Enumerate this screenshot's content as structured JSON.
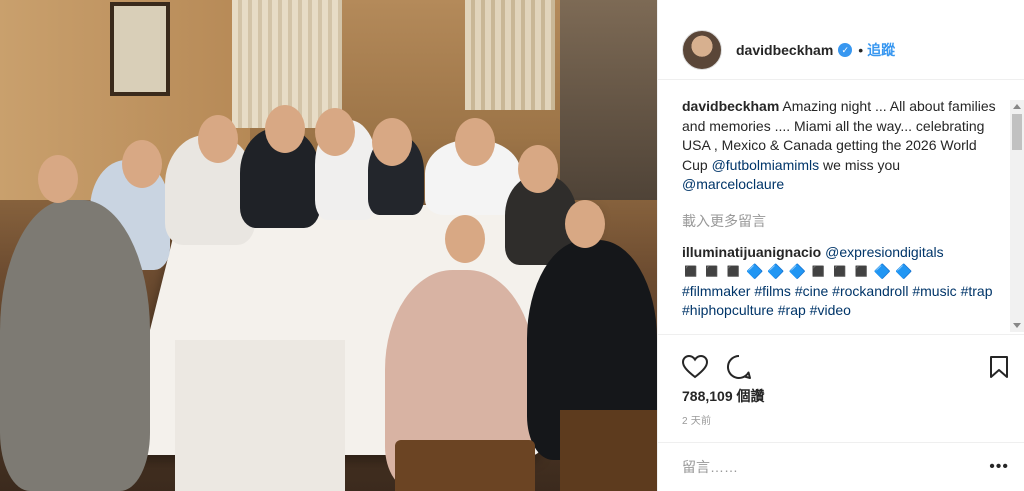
{
  "post": {
    "image_alt": "",
    "username": "davidbeckham",
    "follow_label": "追蹤",
    "separator": "•"
  },
  "caption": {
    "username": "davidbeckham",
    "text_1": "Amazing night ... All about families and memories .... Miami all the way... celebrating USA , Mexico & Canada getting the 2026 World Cup ",
    "tag_1": "@futbolmiamimls",
    "text_2": " we miss you ",
    "tag_2": "@marceloclaure"
  },
  "load_more_label": "載入更多留言",
  "comment_1": {
    "username": "illuminatijuanignacio",
    "tag": "@expresiondigitals",
    "emoji_line": "◼️ ◼️ ◼️ 🔷 🔷 🔷 ◼️ ◼️ ◼️ 🔷 🔷",
    "hashtags": [
      "#filmmaker",
      "#films",
      "#cine",
      "#rockandroll",
      "#music",
      "#trap",
      "#hiphopculture",
      "#rap",
      "#video"
    ]
  },
  "likes_text": "788,109 個讚",
  "time_text": "2 天前",
  "add_comment_placeholder": "留言……",
  "more_options_label": "•••",
  "icons": {
    "verified": "verified-badge-icon",
    "like": "heart-icon",
    "comment": "comment-bubble-icon",
    "save": "bookmark-icon",
    "more": "more-options-icon"
  },
  "colors": {
    "link_blue": "#3897f0",
    "tag_blue": "#003569",
    "text": "#262626",
    "muted": "#999999"
  }
}
